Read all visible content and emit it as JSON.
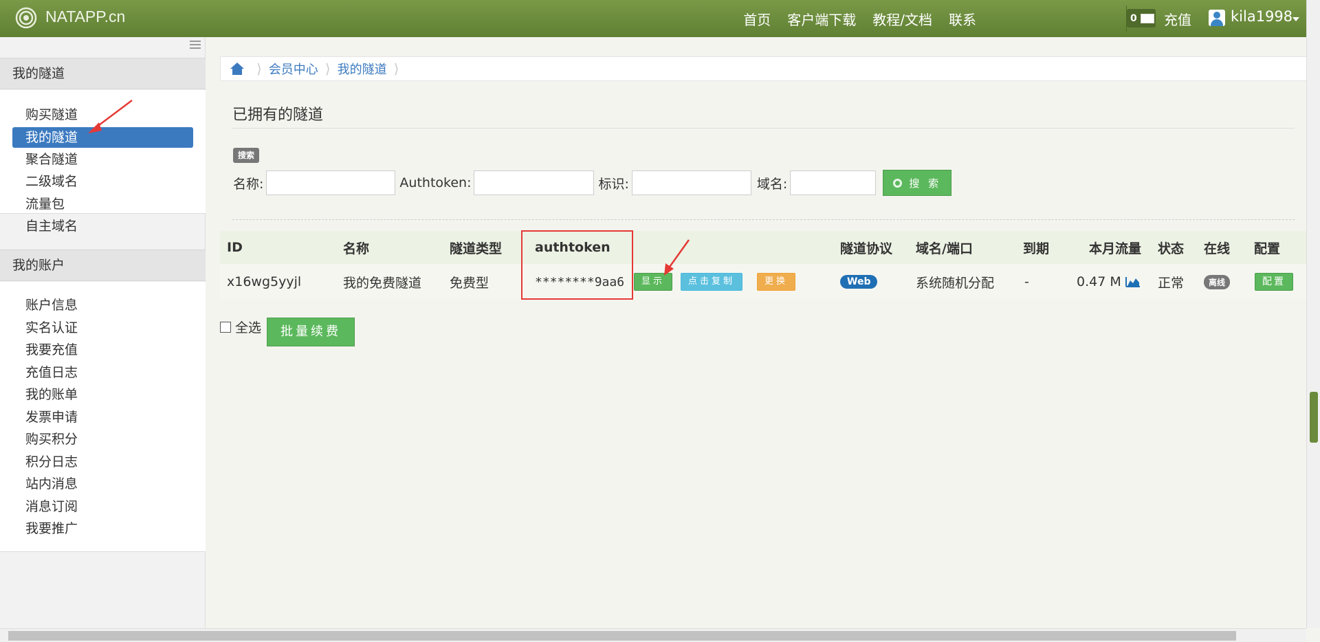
{
  "brand": {
    "name": "NATAPP.cn"
  },
  "nav": {
    "links": [
      "首页",
      "客户端下载",
      "教程/文档",
      "联系"
    ],
    "mail_count": "0",
    "recharge": "充值",
    "username": "kila1998"
  },
  "sidebar": {
    "sections": [
      {
        "title": "我的隧道",
        "items": [
          "购买隧道",
          "我的隧道",
          "聚合隧道",
          "二级域名",
          "流量包",
          "自主域名"
        ]
      },
      {
        "title": "我的账户",
        "items": [
          "账户信息",
          "实名认证",
          "我要充值",
          "充值日志",
          "我的账单",
          "发票申请",
          "购买积分",
          "积分日志",
          "站内消息",
          "消息订阅",
          "我要推广"
        ]
      }
    ],
    "active_item": "我的隧道"
  },
  "breadcrumb": [
    "会员中心",
    "我的隧道"
  ],
  "page_title": "已拥有的隧道",
  "search": {
    "badge": "搜索",
    "fields": [
      "名称:",
      "Authtoken:",
      "标识:",
      "域名:"
    ],
    "button": "搜 索"
  },
  "table": {
    "headers": [
      "ID",
      "名称",
      "隧道类型",
      "authtoken",
      "隧道协议",
      "域名/端口",
      "到期",
      "本月流量",
      "状态",
      "在线",
      "配置"
    ],
    "row": {
      "id": "x16wg5yyjl",
      "name": "我的免费隧道",
      "type": "免费型",
      "authtoken": "********9aa6",
      "btn_show": "显示",
      "btn_copy": "点击复制",
      "btn_change": "更换",
      "protocol": "Web",
      "domain": "系统随机分配",
      "expire": "-",
      "traffic": "0.47 M",
      "status": "正常",
      "online": "离线",
      "config": "配置"
    }
  },
  "bulk": {
    "select_all": "全选",
    "renew": "批量续费"
  },
  "colors": {
    "navbar": "#6b8a3c",
    "active": "#3c7ac0",
    "annotation": "#e53935"
  }
}
